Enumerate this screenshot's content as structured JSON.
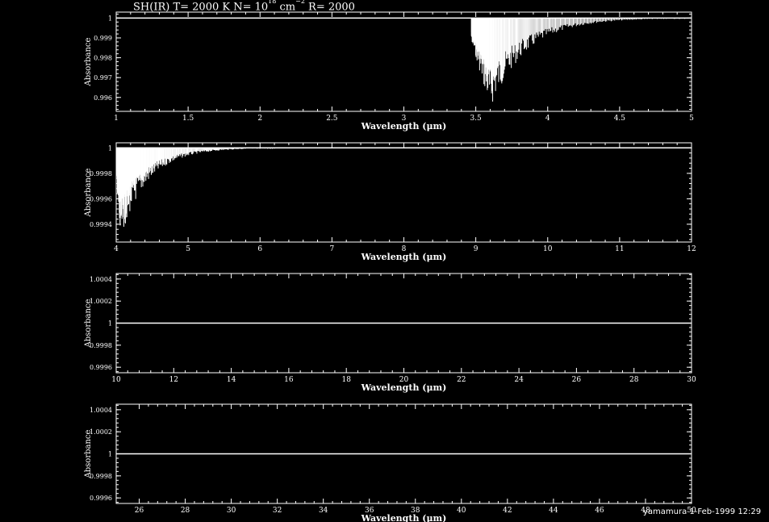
{
  "title": {
    "molecule": "SH(IR)",
    "temperature": "T= 2000 K",
    "column_prefix": "N= 10",
    "column_exponent": "18",
    "column_unit": "cm",
    "column_unit_exponent": "−2",
    "resolution": "R= 2000"
  },
  "footer": "yamamura  1-Feb-1999 12:29",
  "colors": {
    "background": "#000000",
    "foreground": "#ffffff"
  },
  "chart_data": [
    {
      "type": "line",
      "xlabel": "Wavelength (μm)",
      "ylabel": "Absorbance",
      "xlim": [
        1,
        5
      ],
      "ylim": [
        0.9953,
        1.0003
      ],
      "xticks": [
        1,
        1.5,
        2,
        2.5,
        3,
        3.5,
        4,
        4.5,
        5
      ],
      "xtick_labels": [
        "1",
        "1.5",
        "2",
        "2.5",
        "3",
        "3.5",
        "4",
        "4.5",
        "5"
      ],
      "yticks": [
        0.996,
        0.997,
        0.998,
        0.999,
        1
      ],
      "ytick_labels": [
        "0.996",
        "0.997",
        "0.998",
        "0.999",
        "1"
      ],
      "continuum": 1,
      "band": {
        "start": 3.47,
        "peak": 3.6,
        "min_value": 0.9954,
        "end": 5.0
      }
    },
    {
      "type": "line",
      "xlabel": "Wavelength (μm)",
      "ylabel": "Absorbance",
      "xlim": [
        4,
        12
      ],
      "ylim": [
        0.99926,
        1.00004
      ],
      "xticks": [
        4,
        5,
        6,
        7,
        8,
        9,
        10,
        11,
        12
      ],
      "xtick_labels": [
        "4",
        "5",
        "6",
        "7",
        "8",
        "9",
        "10",
        "11",
        "12"
      ],
      "yticks": [
        0.9994,
        0.9996,
        0.9998,
        1
      ],
      "ytick_labels": [
        "0.9994",
        "0.9996",
        "0.9998",
        "1"
      ],
      "continuum": 1,
      "band": {
        "start": 4.0,
        "peak": 4.05,
        "min_value": 0.99927,
        "end": 6.2
      }
    },
    {
      "type": "line",
      "xlabel": "Wavelength (μm)",
      "ylabel": "Absorbance",
      "xlim": [
        10,
        30
      ],
      "ylim": [
        0.99955,
        1.00045
      ],
      "xticks": [
        10,
        12,
        14,
        16,
        18,
        20,
        22,
        24,
        26,
        28,
        30
      ],
      "xtick_labels": [
        "10",
        "12",
        "14",
        "16",
        "18",
        "20",
        "22",
        "24",
        "26",
        "28",
        "30"
      ],
      "yticks": [
        0.9996,
        0.9998,
        1,
        1.0002,
        1.0004
      ],
      "ytick_labels": [
        "0.9996",
        "0.9998",
        "1",
        "1.0002",
        "1.0004"
      ],
      "continuum": 1
    },
    {
      "type": "line",
      "xlabel": "Wavelength (μm)",
      "ylabel": "Absorbance",
      "xlim": [
        25,
        50
      ],
      "ylim": [
        0.99955,
        1.00045
      ],
      "xticks": [
        26,
        28,
        30,
        32,
        34,
        36,
        38,
        40,
        42,
        44,
        46,
        48,
        50
      ],
      "xtick_labels": [
        "26",
        "28",
        "30",
        "32",
        "34",
        "36",
        "38",
        "40",
        "42",
        "44",
        "46",
        "48",
        "50"
      ],
      "yticks": [
        0.9996,
        0.9998,
        1,
        1.0002,
        1.0004
      ],
      "ytick_labels": [
        "0.9996",
        "0.9998",
        "1",
        "1.0002",
        "1.0004"
      ],
      "continuum": 1
    }
  ]
}
